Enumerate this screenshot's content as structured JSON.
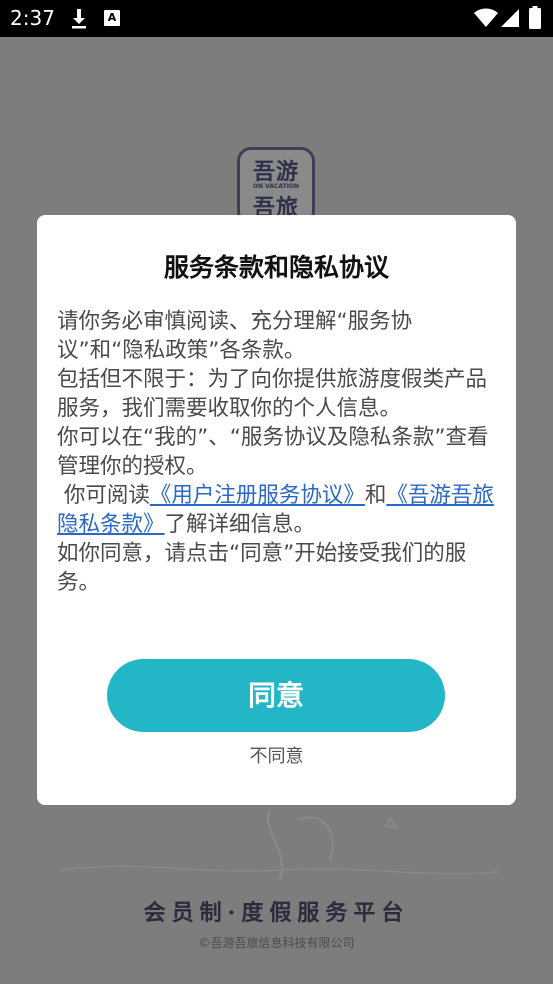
{
  "status_bar": {
    "time": "2:37",
    "icons": [
      "download-icon",
      "a-notification-icon",
      "wifi-icon",
      "signal-icon",
      "battery-icon"
    ]
  },
  "splash": {
    "logo_top": "吾游",
    "logo_sub": "ON VACATION",
    "logo_bottom": "吾旅",
    "slogan": "会员制·度假服务平台",
    "copyright": "©吾游吾旅信息科技有限公司"
  },
  "dialog": {
    "title": "服务条款和隐私协议",
    "paragraphs": {
      "p1": "请你务必审慎阅读、充分理解“服务协议”和“隐私政策”各条款。",
      "p2": "包括但不限于：为了向你提供旅游度假类产品服务，我们需要收取你的个人信息。",
      "p3": "你可以在“我的”、“服务协议及隐私条款”查看管理你的授权。",
      "p4_prefix": " 你可阅读",
      "p4_link1": "《用户注册服务协议》",
      "p4_mid": "和",
      "p4_link2": "《吾游吾旅隐私条款》",
      "p4_suffix": "了解详细信息。",
      "p5": "如你同意，请点击“同意”开始接受我们的服务。"
    },
    "agree_label": "同意",
    "disagree_label": "不同意"
  },
  "colors": {
    "accent": "#22b6c6",
    "link": "#2b67c6",
    "overlay": "#7d7d7d"
  }
}
